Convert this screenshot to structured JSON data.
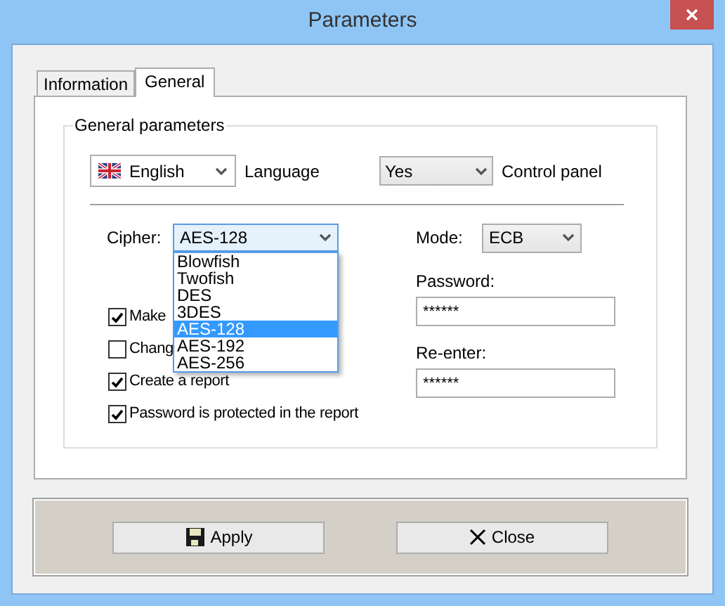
{
  "window": {
    "title": "Parameters"
  },
  "tabs": [
    {
      "label": "Information",
      "selected": false
    },
    {
      "label": "General",
      "selected": true
    }
  ],
  "group": {
    "title": "General parameters",
    "language": {
      "value": "English",
      "label": "Language"
    },
    "control_panel": {
      "value": "Yes",
      "label": "Control panel"
    },
    "cipher": {
      "label": "Cipher:",
      "value": "AES-128",
      "expanded": true,
      "options": [
        {
          "label": "Blowfish",
          "selected": false
        },
        {
          "label": "Twofish",
          "selected": false
        },
        {
          "label": "DES",
          "selected": false
        },
        {
          "label": "3DES",
          "selected": false
        },
        {
          "label": "AES-128",
          "selected": true
        },
        {
          "label": "AES-192",
          "selected": false
        },
        {
          "label": "AES-256",
          "selected": false
        }
      ]
    },
    "mode": {
      "label": "Mode:",
      "value": "ECB"
    },
    "checkboxes": [
      {
        "label": "Make",
        "checked": true
      },
      {
        "label": "Chang",
        "checked": false
      },
      {
        "label": "Create a report",
        "checked": true
      },
      {
        "label": "Password is protected in the report",
        "checked": true
      }
    ],
    "password": {
      "label": "Password:",
      "value": "******"
    },
    "reenter": {
      "label": "Re-enter:",
      "value": "******"
    }
  },
  "buttons": [
    {
      "label": "Apply",
      "kind": "save"
    },
    {
      "label": "Close",
      "kind": "close"
    }
  ]
}
